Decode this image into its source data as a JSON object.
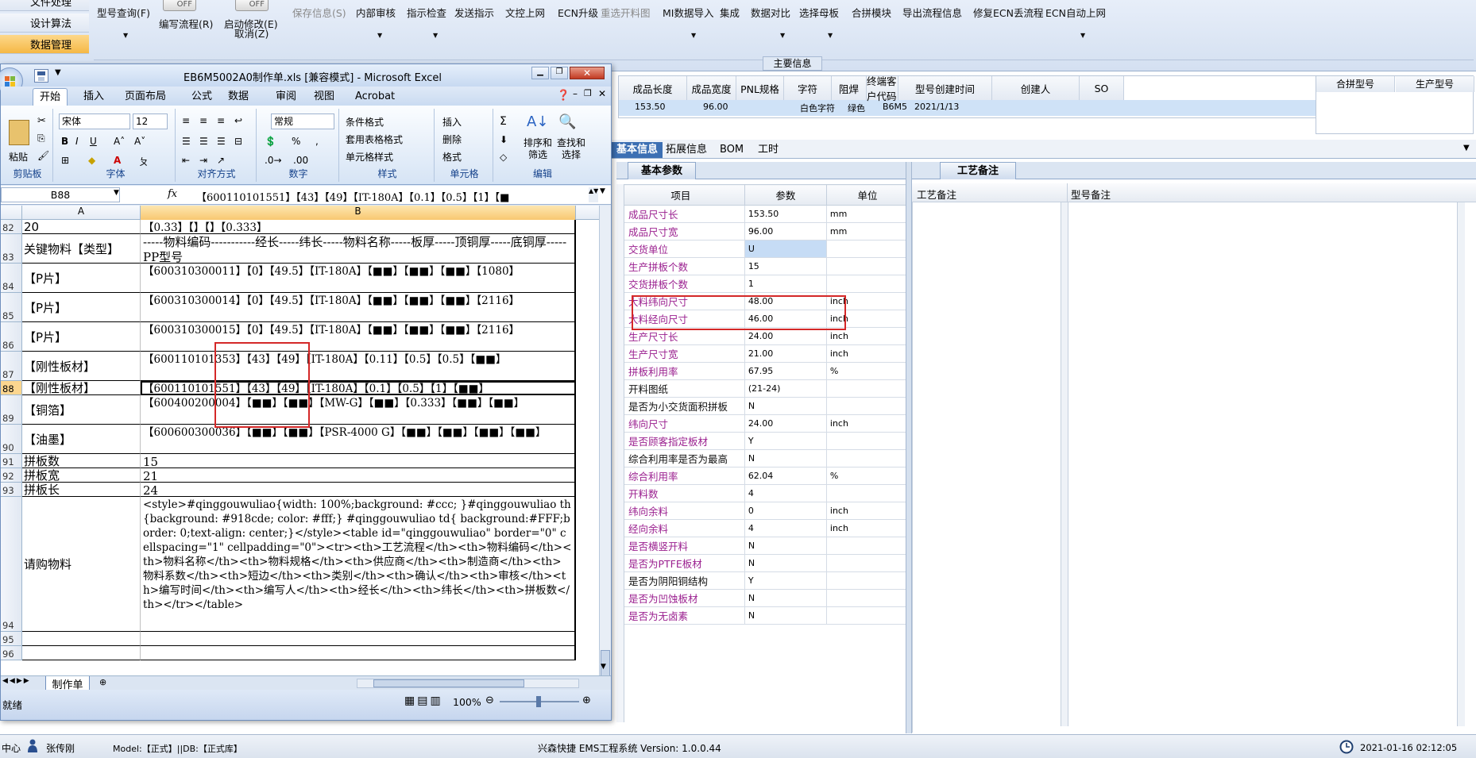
{
  "app": {
    "left_nav": [
      "文件处理",
      "设计算法",
      "数据管理"
    ],
    "toolbar": [
      "型号查询(F)",
      "编写流程(R)",
      "启动修改(E)",
      "取消(Z)",
      "保存信息(S)",
      "内部审核",
      "指示检查",
      "发送指示",
      "文控上网",
      "ECN升级",
      "重选开料图",
      "MI数据导入",
      "集成",
      "数据对比",
      "选择母板",
      "合拼模块",
      "导出流程信息",
      "修复ECN丢流程",
      "ECN自动上网"
    ],
    "toggle_off": "OFF",
    "main_info_label": "主要信息",
    "grid_headers": [
      "成品长度",
      "成品宽度",
      "PNL规格",
      "字符",
      "阻焊",
      "终端客户代码",
      "型号创建时间",
      "创建人",
      "SO"
    ],
    "grid_row": [
      "153.50",
      "96.00",
      "",
      "白色字符",
      "绿色",
      "B6M5",
      "2021/1/13",
      "",
      ""
    ],
    "grid2_headers": [
      "合拼型号",
      "生产型号"
    ],
    "tabs": [
      "基本信息",
      "拓展信息",
      "BOM",
      "工时"
    ],
    "basic_params": {
      "tab": "基本参数",
      "headers": [
        "项目",
        "参数",
        "单位"
      ],
      "rows": [
        {
          "name": "成品尺寸长",
          "value": "153.50",
          "unit": "mm",
          "purple": true
        },
        {
          "name": "成品尺寸宽",
          "value": "96.00",
          "unit": "mm",
          "purple": true
        },
        {
          "name": "交货单位",
          "value": "U",
          "unit": "",
          "purple": true
        },
        {
          "name": "生产拼板个数",
          "value": "15",
          "unit": "",
          "purple": true
        },
        {
          "name": "交货拼板个数",
          "value": "1",
          "unit": "",
          "purple": true
        },
        {
          "name": "大料纬向尺寸",
          "value": "48.00",
          "unit": "inch",
          "purple": true
        },
        {
          "name": "大料经向尺寸",
          "value": "46.00",
          "unit": "inch",
          "purple": true
        },
        {
          "name": "生产尺寸长",
          "value": "24.00",
          "unit": "inch",
          "purple": true
        },
        {
          "name": "生产尺寸宽",
          "value": "21.00",
          "unit": "inch",
          "purple": true
        },
        {
          "name": "拼板利用率",
          "value": "67.95",
          "unit": "%",
          "purple": true
        },
        {
          "name": "开料图纸",
          "value": "(21-24)",
          "unit": "",
          "purple": false
        },
        {
          "name": "是否为小交货面积拼板",
          "value": "N",
          "unit": "",
          "purple": false
        },
        {
          "name": "纬向尺寸",
          "value": "24.00",
          "unit": "inch",
          "purple": true
        },
        {
          "name": "是否顾客指定板材",
          "value": "Y",
          "unit": "",
          "purple": true
        },
        {
          "name": "综合利用率是否为最高",
          "value": "N",
          "unit": "",
          "purple": false
        },
        {
          "name": "综合利用率",
          "value": "62.04",
          "unit": "%",
          "purple": true
        },
        {
          "name": "开料数",
          "value": "4",
          "unit": "",
          "purple": true
        },
        {
          "name": "纬向余料",
          "value": "0",
          "unit": "inch",
          "purple": true
        },
        {
          "name": "经向余料",
          "value": "4",
          "unit": "inch",
          "purple": true
        },
        {
          "name": "是否横竖开料",
          "value": "N",
          "unit": "",
          "purple": true
        },
        {
          "name": "是否为PTFE板材",
          "value": "N",
          "unit": "",
          "purple": true
        },
        {
          "name": "是否为阴阳铜结构",
          "value": "Y",
          "unit": "",
          "purple": false
        },
        {
          "name": "是否为凹蚀板材",
          "value": "N",
          "unit": "",
          "purple": true
        },
        {
          "name": "是否为无卤素",
          "value": "N",
          "unit": "",
          "purple": true
        }
      ]
    },
    "process_note": {
      "tab": "工艺备注",
      "col1": "工艺备注",
      "col2": "型号备注"
    },
    "status": {
      "left": "中心",
      "user": "张传刚",
      "model": "Model:【正式】||DB:【正式库】",
      "system": "兴森快捷 EMS工程系统 Version: 1.0.0.44",
      "time": "2021-01-16 02:12:05"
    }
  },
  "excel": {
    "title": "EB6M5002A0制作单.xls  [兼容模式] - Microsoft Excel",
    "tabs": [
      "开始",
      "插入",
      "页面布局",
      "公式",
      "数据",
      "审阅",
      "视图",
      "Acrobat"
    ],
    "ribbon": {
      "paste": "粘贴",
      "clipboard": "剪贴板",
      "font_name": "宋体",
      "font_size": "12",
      "font": "字体",
      "align": "对齐方式",
      "num_format": "常规",
      "number": "数字",
      "cond_format": "条件格式",
      "table_format": "套用表格格式",
      "cell_style": "单元格样式",
      "styles": "样式",
      "insert": "插入",
      "delete": "删除",
      "format": "格式",
      "cells": "单元格",
      "sort": "排序和\n筛选",
      "find": "查找和\n选择",
      "edit": "编辑"
    },
    "name_box": "B88",
    "formula": "【600110101551】【43】【49】【IT-180A】【0.1】【0.5】【1】【■",
    "cols": [
      "A",
      "B"
    ],
    "rows": [
      {
        "n": "82",
        "a": "20",
        "b": "【0.33】【】【】【0.333】",
        "h": 18
      },
      {
        "n": "83",
        "a": "关键物料【类型】",
        "b": "-----物料编码-----------经长-----纬长-----物料名称-----板厚-----顶铜厚-----底铜厚-----PP型号",
        "h": 37,
        "big": true
      },
      {
        "n": "84",
        "a": "【P片】",
        "b": "【600310300011】【0】【49.5】【IT-180A】【■■】【■■】【■■】【1080】",
        "h": 37
      },
      {
        "n": "85",
        "a": "【P片】",
        "b": "【600310300014】【0】【49.5】【IT-180A】【■■】【■■】【■■】【2116】",
        "h": 37
      },
      {
        "n": "86",
        "a": "【P片】",
        "b": "【600310300015】【0】【49.5】【IT-180A】【■■】【■■】【■■】【2116】",
        "h": 37
      },
      {
        "n": "87",
        "a": "【刚性板材】",
        "b": "【600110101353】【43】【49】【IT-180A】【0.11】【0.5】【0.5】【■■】",
        "h": 37
      },
      {
        "n": "88",
        "a": "【刚性板材】",
        "b": "【600110101551】【43】【49】【IT-180A】【0.1】【0.5】【1】【■■】",
        "h": 18,
        "sel": true
      },
      {
        "n": "89",
        "a": "【铜箔】",
        "b": "【600400200004】【■■】【■■】【MW-G】【■■】【0.333】【■■】【■■】",
        "h": 37
      },
      {
        "n": "90",
        "a": "【油墨】",
        "b": "【600600300036】【■■】【■■】【PSR-4000 G】【■■】【■■】【■■】【■■】",
        "h": 37
      },
      {
        "n": "91",
        "a": "拼板数",
        "b": "15",
        "h": 18,
        "big": true
      },
      {
        "n": "92",
        "a": "拼板宽",
        "b": "21",
        "h": 18,
        "big": true
      },
      {
        "n": "93",
        "a": "拼板长",
        "b": "24",
        "h": 18,
        "big": true
      },
      {
        "n": "94",
        "a": "请购物料",
        "b": "<style>#qinggouwuliao{width: 100%;background: #ccc; }#qinggouwuliao th{background: #918cde; color: #fff;} #qinggouwuliao td{ background:#FFF;border: 0;text-align: center;}</style><table id=\"qinggouwuliao\" border=\"0\" cellspacing=\"1\" cellpadding=\"0\"><tr><th>工艺流程</th><th>物料编码</th><th>物料名称</th><th>物料规格</th><th>供应商</th><th>制造商</th><th>物料系数</th><th>短边</th><th>类别</th><th>确认</th><th>审核</th><th>编写时间</th><th>编写人</th><th>经长</th><th>纬长</th><th>拼板数</th></tr></table>",
        "h": 170
      },
      {
        "n": "95",
        "a": "",
        "b": "",
        "h": 18
      },
      {
        "n": "96",
        "a": "",
        "b": "",
        "h": 18
      }
    ],
    "sheet_tab": "制作单",
    "status": "就绪",
    "zoom": "100%"
  }
}
